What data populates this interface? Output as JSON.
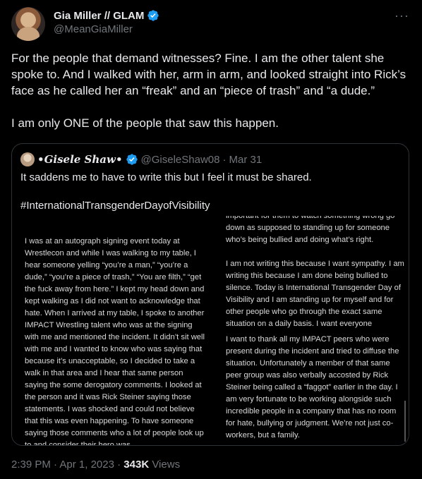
{
  "author": {
    "display_name": "Gia Miller // GLAM",
    "handle": "@MeanGiaMiller",
    "verified_badge": "verified-badge-icon"
  },
  "more_label": "···",
  "tweet": {
    "paragraph1": "For the people that demand witnesses? Fine. I am the other talent she spoke to. And I walked with her, arm in arm, and looked straight into Rick’s face as he called her an “freak” and an “piece of trash” and “a dude.”",
    "paragraph2": "I am only ONE of the people that saw this happen."
  },
  "quote": {
    "display_name": "Gisele Shaw",
    "name_decoration": "•",
    "handle": "@GiseleShaw08",
    "separator": "·",
    "date": "Mar 31",
    "text1": "It saddens me to have to write this but I feel it must be shared.",
    "text2": "#InternationalTransgenderDayofVisibility"
  },
  "media": {
    "left_column": "I was at an autograph signing event today at Wrestlecon and while I was walking to my table, I hear someone yelling “you’re a man,” “you’re a dude,” “you’re a piece of trash,” “You are filth,” “get the fuck away from here.” I kept my head down and kept walking as I did not  want to acknowledge that hate. When I arrived at my table, I spoke to another IMPACT Wrestling talent who was at the signing with me and mentioned the incident. It didn’t sit well with me and I wanted to know who was saying that because it’s unacceptable, so I decided to take a walk in that area and I hear that same person saying the some derogatory comments. I looked at the person and it was Rick Steiner saying those statements. I was shocked and could not believe that this was even happening. To have someone saying those comments who a lot of people look up to and consider their hero was",
    "right_top_p1": "important for them to watch something wrong go down as supposed to standing up for someone who’s being bullied and doing what’s right.",
    "right_top_p2": "I am not writing this because I want sympathy. I am writing this because I am done being bullied to silence. Today is International Transgender Day of Visibility and I am standing up for myself and for other people who go through the exact same situation on a daily basis. I want everyone",
    "right_bottom": "I want to thank all my IMPACT peers who were present during the incident and tried to diffuse the situation. Unfortunately a member of that same peer group was also verbally accosted by Rick Steiner being called a “faggot” earlier in the day. I am very fortunate to be working alongside such incredible people in a company that has no room for hate, bullying or judgment. We’re not just co-workers, but a family."
  },
  "meta": {
    "time": "2:39 PM",
    "separator": "·",
    "date": "Apr 1, 2023",
    "views_count": "343K",
    "views_label": "Views"
  },
  "colors": {
    "background": "#000000",
    "text": "#e7e9ea",
    "secondary": "#71767b",
    "verified": "#1d9bf0",
    "border": "#2f3336"
  }
}
